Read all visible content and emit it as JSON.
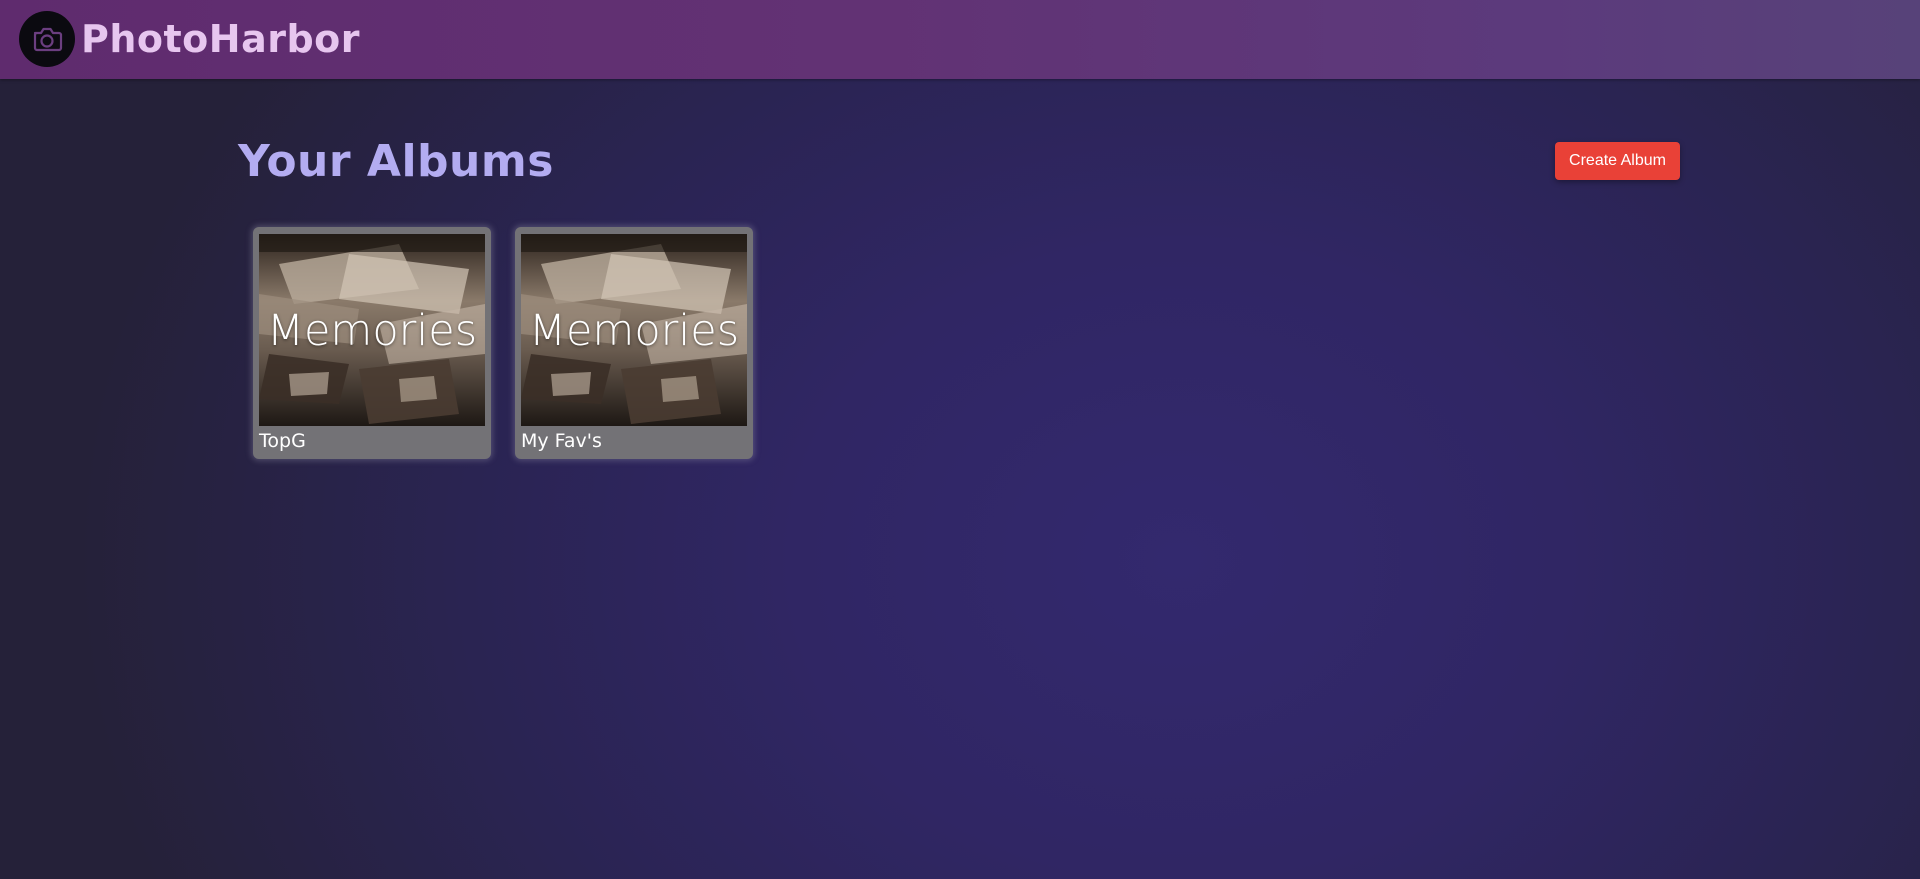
{
  "header": {
    "brand": "PhotoHarbor",
    "logo_icon": "camera-icon",
    "colors": {
      "bar": "#5f2b6e",
      "brand_text": "#e7c6ef"
    }
  },
  "main": {
    "title": "Your Albums",
    "create_button_label": "Create Album",
    "colors": {
      "title": "#b3acf1",
      "create_button": "#e94137",
      "background": "#2a2452"
    },
    "albums": [
      {
        "name": "TopG",
        "cover_text": "Memories"
      },
      {
        "name": "My Fav's",
        "cover_text": "Memories"
      }
    ]
  }
}
